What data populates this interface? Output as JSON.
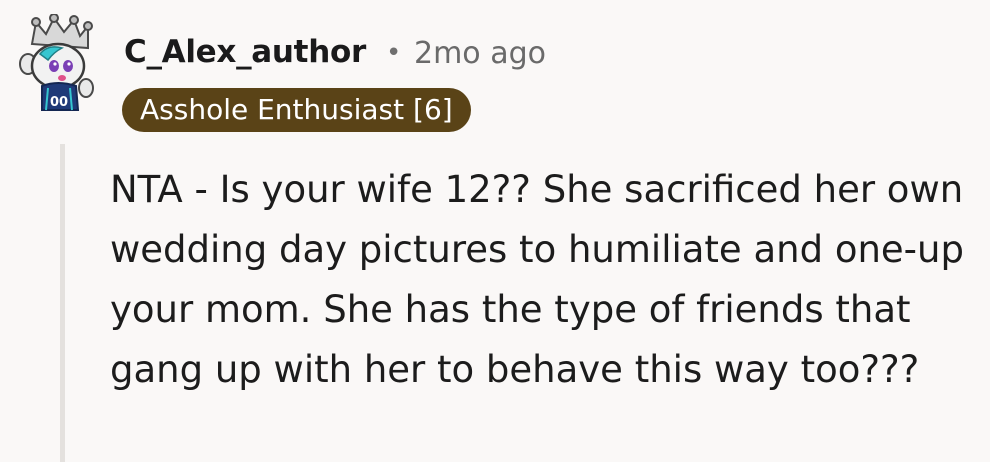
{
  "comment": {
    "username": "C_Alex_author",
    "separator": "•",
    "timestamp": "2mo ago",
    "flair": "Asshole Enthusiast [6]",
    "body": "NTA - Is your wife 12?? She sacrificed her own wedding day pictures to humiliate and one-up your mom. She has the type of friends that gang up with her to behave this way too???",
    "avatar": {
      "icon": "snoo-avatar-icon",
      "jersey_number": "00"
    }
  },
  "colors": {
    "background": "#faf8f7",
    "flair_bg": "#5a4317",
    "flair_text": "#ffffff",
    "username": "#1a1a1b",
    "meta": "#6a6a6a",
    "thread_line": "#e4e1de"
  }
}
